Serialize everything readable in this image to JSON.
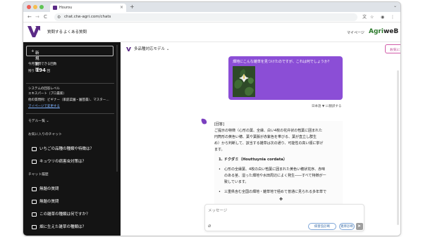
{
  "browser": {
    "tab_title": "Hourou",
    "tab_close": "×",
    "new_tab": "+",
    "url": "chat.ctw-agri.com/chats",
    "nav_back": "←",
    "nav_forward": "→",
    "nav_reload": "C"
  },
  "header": {
    "nav": [
      {
        "label": "質問する"
      },
      {
        "label": "よくある質問"
      }
    ],
    "mypage": "マイページ",
    "brand_left": "Agri",
    "brand_right": "weB"
  },
  "sidebar": {
    "new_question": "新規質問",
    "remaining_label": "今月質問できる回数",
    "remaining_prefix": "残り",
    "remaining_count": "194",
    "remaining_suffix": "回",
    "level_line1": "システムの回答レベル",
    "level_line2": "エキスパート（プロ農家）",
    "level_line3": "他の質問例：ビギナー（家庭菜園・園芸農）、マスター…",
    "mypage_link": "マイページで変更する",
    "model_menu": "モデル一覧",
    "favorites_heading": "お気に入りのチャット",
    "favorites": [
      {
        "label": "いちごの品種の種類や特徴は？"
      },
      {
        "label": "キュウリの病害虫対策は？"
      }
    ],
    "history_heading": "チャット履歴",
    "history": [
      {
        "label": "無題の質問"
      },
      {
        "label": "無題の質問"
      },
      {
        "label": "この雑草の種類は何ですか？"
      },
      {
        "label": "畑に生えた雑草の種類は？"
      }
    ]
  },
  "chat": {
    "model_label": "多品種対応モデル",
    "favorite_button": "お気に入り登録",
    "user_message": "畑地にこんな雑草を見つけたのですが、これは何でしょうか？",
    "translate_label": "日本語 ▼ に翻訳する",
    "answer_lines": [
      "[回答]",
      "ご提示の特徴（心形の葉、全縁、白い4枚の花弁状の苞葉に囲まれた",
      "円筒形の黄色い穂、葉や葉脈が赤紫色を帯びる、葉が直立し群生",
      "め）から判断して、該当する雑草は次の通り、可能性の高い順に挙げ",
      "ます。",
      "1. ドクダミ（Houttuynia cordata）",
      "心形の全縁葉、4枚の白い苞葉に囲まれた黄色い穂状花序、赤味",
      "のある茎、湿った畑地や水田周辺によく発生――すべて特徴が一",
      "致しています。",
      "三重県含む全国の畑地・雑草地で極めて普通に見られる多年草で"
    ],
    "input_placeholder": "メッセージ",
    "chip_1": "病害虫診断",
    "chip_2": "雑草診断",
    "send_label": "➤"
  },
  "colors": {
    "accent_purple": "#8b4ed6",
    "brand_green": "#2d7a2d",
    "sidebar_bg": "#141414"
  }
}
